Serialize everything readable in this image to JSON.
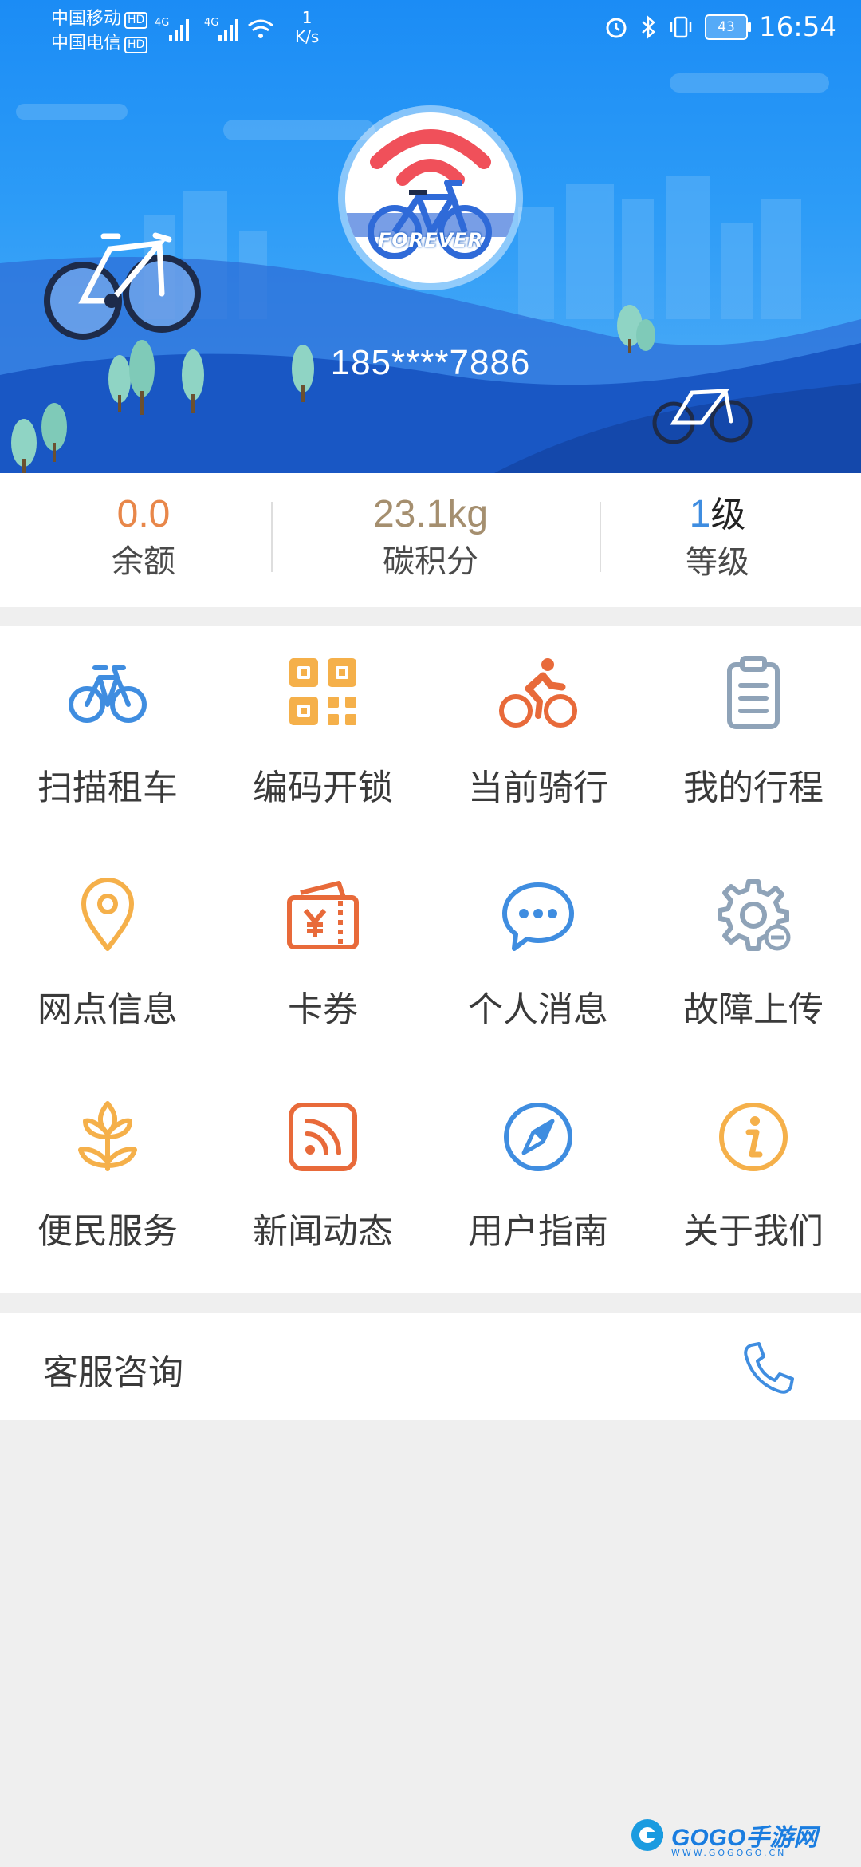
{
  "status_bar": {
    "carrier_1": "中国移动",
    "carrier_2": "中国电信",
    "hd_badge": "HD",
    "network": "4G",
    "speed_value": "1",
    "speed_unit": "K/s",
    "battery": "43",
    "time": "16:54"
  },
  "profile": {
    "avatar_text": "FOREVER",
    "phone": "185****7886"
  },
  "stats": [
    {
      "value": "0.0",
      "label": "余额",
      "color": "#e8874a"
    },
    {
      "value": "23.1kg",
      "label": "碳积分",
      "color": "#a58f6f"
    },
    {
      "value_number": "1",
      "value_unit": "级",
      "label": "等级",
      "number_color": "#3f8de0",
      "unit_color": "#222222"
    }
  ],
  "grid": [
    {
      "label": "扫描租车",
      "icon": "bike-icon",
      "color": "#3f8de0"
    },
    {
      "label": "编码开锁",
      "icon": "qr-code-icon",
      "color": "#f5b04a"
    },
    {
      "label": "当前骑行",
      "icon": "cyclist-icon",
      "color": "#e86a3a"
    },
    {
      "label": "我的行程",
      "icon": "clipboard-icon",
      "color": "#8fa3b8"
    },
    {
      "label": "网点信息",
      "icon": "location-pin-icon",
      "color": "#f5b04a"
    },
    {
      "label": "卡券",
      "icon": "coupon-icon",
      "color": "#e86a3a"
    },
    {
      "label": "个人消息",
      "icon": "chat-bubble-icon",
      "color": "#3f8de0"
    },
    {
      "label": "故障上传",
      "icon": "gear-icon",
      "color": "#8fa3b8"
    },
    {
      "label": "便民服务",
      "icon": "lotus-icon",
      "color": "#f5b04a"
    },
    {
      "label": "新闻动态",
      "icon": "rss-icon",
      "color": "#e86a3a"
    },
    {
      "label": "用户指南",
      "icon": "compass-icon",
      "color": "#3f8de0"
    },
    {
      "label": "关于我们",
      "icon": "info-icon",
      "color": "#f5b04a"
    }
  ],
  "service": {
    "label": "客服咨询",
    "icon": "phone-icon",
    "color": "#3f8de0"
  },
  "watermark": {
    "text": "GOGO手游网",
    "sub": "WWW.GOGOGO.CN"
  }
}
